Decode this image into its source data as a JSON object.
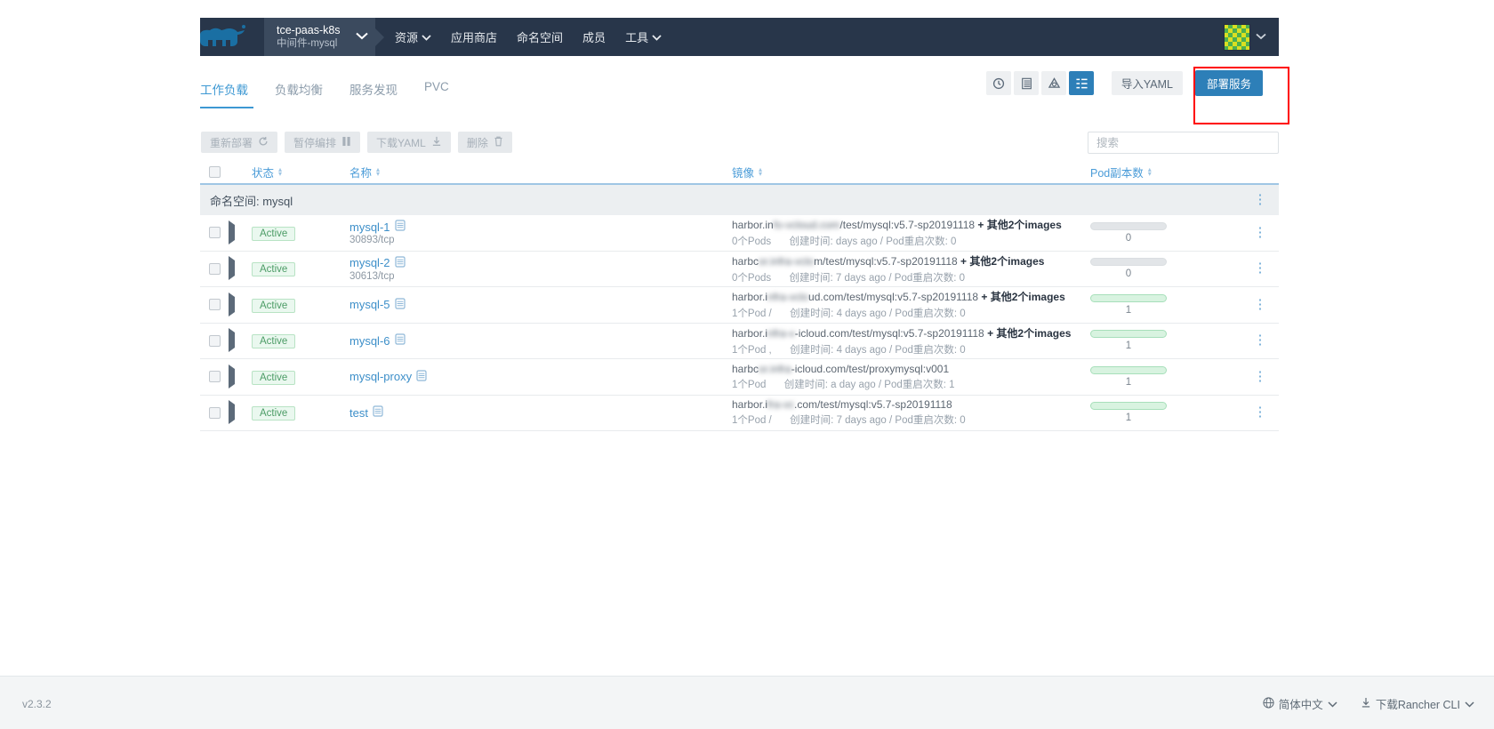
{
  "header": {
    "logo_icon": "cow-logo-icon",
    "context": {
      "title": "tce-paas-k8s",
      "subtitle": "中间件-mysql",
      "caret": "⌄"
    },
    "nav": [
      {
        "label": "资源",
        "has_caret": true
      },
      {
        "label": "应用商店",
        "has_caret": false
      },
      {
        "label": "命名空间",
        "has_caret": false
      },
      {
        "label": "成员",
        "has_caret": false
      },
      {
        "label": "工具",
        "has_caret": true
      }
    ],
    "avatar_caret": "⌄"
  },
  "tabs": [
    {
      "label": "工作负载",
      "active": true
    },
    {
      "label": "负载均衡",
      "active": false
    },
    {
      "label": "服务发现",
      "active": false
    },
    {
      "label": "PVC",
      "active": false
    }
  ],
  "view_tools": [
    {
      "name": "clock-icon",
      "glyph": "◴",
      "active": false
    },
    {
      "name": "list-lines-icon",
      "glyph": "☰",
      "active": false
    },
    {
      "name": "cloud-icon",
      "glyph": "△",
      "active": false
    },
    {
      "name": "grouped-list-icon",
      "glyph": "≣",
      "active": true
    }
  ],
  "toolbar": {
    "import_yaml": "导入YAML",
    "deploy_service": "部署服务"
  },
  "actions": [
    {
      "label": "重新部署",
      "icon": "↺",
      "icon_name": "redeploy-icon"
    },
    {
      "label": "暂停编排",
      "icon": "‖",
      "icon_name": "pause-icon"
    },
    {
      "label": "下载YAML",
      "icon": "⤓",
      "icon_name": "download-icon"
    },
    {
      "label": "删除",
      "icon": "Ὕ1",
      "icon_name": "trash-icon"
    }
  ],
  "search": {
    "placeholder": "搜索",
    "value": ""
  },
  "table": {
    "columns": {
      "state": "状态",
      "name": "名称",
      "image": "镜像",
      "pods": "Pod副本数"
    },
    "group_label": "命名空间: mysql",
    "rows": [
      {
        "state": "Active",
        "name": "mysql-1",
        "name_sub": "30893/tcp",
        "image_prefix": "harbor.in",
        "image_blurred": "fo-vcloud.com",
        "image_suffix": "/test/mysql:v5.7-sp20191118",
        "image_extra": "+ 其他2个images",
        "detail_pods": "0个Pods",
        "detail_created_label": "创建时间:",
        "detail_created": "days ago",
        "detail_restarts": "Pod重启次数: 0",
        "pod_count": "0",
        "pod_fill": 0
      },
      {
        "state": "Active",
        "name": "mysql-2",
        "name_sub": "30613/tcp",
        "image_prefix": "harbc",
        "image_blurred": "or.infra-vclo",
        "image_suffix": "m/test/mysql:v5.7-sp20191118",
        "image_extra": "+ 其他2个images",
        "detail_pods": "0个Pods",
        "detail_created_label": "创建时间:",
        "detail_created": "7 days ago",
        "detail_restarts": "Pod重启次数: 0",
        "pod_count": "0",
        "pod_fill": 0
      },
      {
        "state": "Active",
        "name": "mysql-5",
        "name_sub": "",
        "image_prefix": "harbor.i",
        "image_blurred": "nfra-vclo",
        "image_suffix": "ud.com/test/mysql:v5.7-sp20191118",
        "image_extra": "+ 其他2个images",
        "detail_pods": "1个Pod /",
        "detail_created_label": "创建时间:",
        "detail_created": "4 days ago",
        "detail_restarts": "Pod重启次数: 0",
        "pod_count": "1",
        "pod_fill": 100
      },
      {
        "state": "Active",
        "name": "mysql-6",
        "name_sub": "",
        "image_prefix": "harbor.i",
        "image_blurred": "nfra-v",
        "image_suffix": "-icloud.com/test/mysql:v5.7-sp20191118",
        "image_extra": "+ 其他2个images",
        "detail_pods": "1个Pod ,",
        "detail_created_label": "创建时间:",
        "detail_created": "4 days ago",
        "detail_restarts": "Pod重启次数: 0",
        "pod_count": "1",
        "pod_fill": 100
      },
      {
        "state": "Active",
        "name": "mysql-proxy",
        "name_sub": "",
        "image_prefix": "harbc",
        "image_blurred": "or.infra",
        "image_suffix": "-icloud.com/test/proxymysql:v001",
        "image_extra": "",
        "detail_pods": "1个Pod",
        "detail_created_label": "创建时间:",
        "detail_created": "a day ago",
        "detail_restarts": "Pod重启次数: 1",
        "pod_count": "1",
        "pod_fill": 100
      },
      {
        "state": "Active",
        "name": "test",
        "name_sub": "",
        "image_prefix": "harbor.i",
        "image_blurred": "fra-vc",
        "image_suffix": ".com/test/mysql:v5.7-sp20191118",
        "image_extra": "",
        "detail_pods": "1个Pod /",
        "detail_created_label": "创建时间:",
        "detail_created": "7 days ago",
        "detail_restarts": "Pod重启次数: 0",
        "pod_count": "1",
        "pod_fill": 100
      }
    ]
  },
  "footer": {
    "version": "v2.3.2",
    "language": "简体中文",
    "download_cli": "下载Rancher CLI"
  },
  "colors": {
    "header_bg": "#28364a",
    "accent": "#2d7fb8",
    "link": "#3d8fc9",
    "active_badge": "#4c9c66",
    "highlight_box": "#ff0000"
  }
}
